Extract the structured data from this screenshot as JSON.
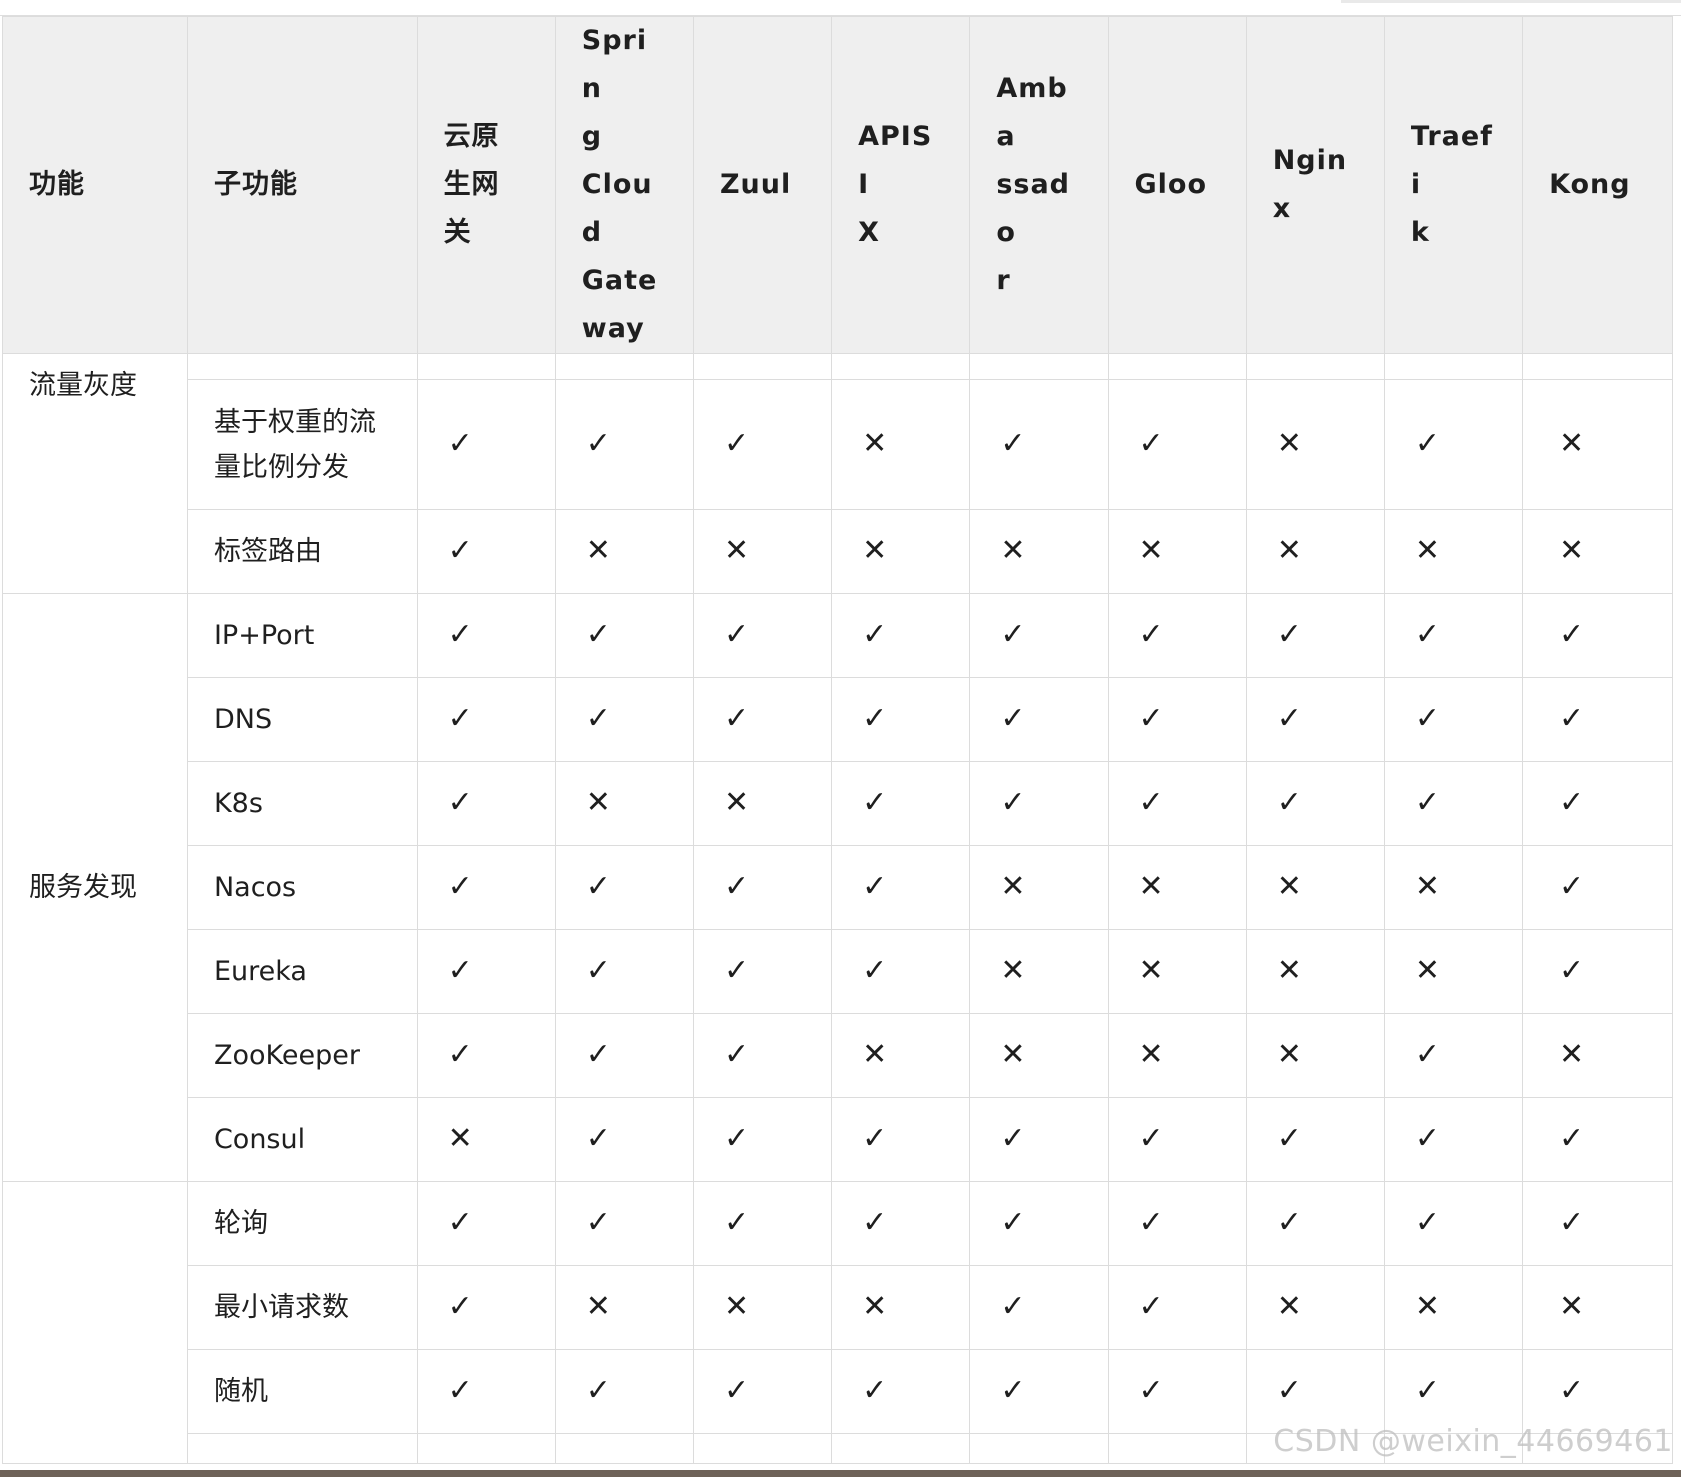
{
  "table": {
    "headers": [
      "功能",
      "子功能",
      "云原生网关",
      "Spring Cloud Gateway",
      "Zuul",
      "APISIX",
      "Ambassador",
      "Gloo",
      "Nginx",
      "Traefik",
      "Kong"
    ],
    "header_lines": [
      [
        "功能"
      ],
      [
        "子功能"
      ],
      [
        "云原",
        "生网",
        "关"
      ],
      [
        "Sprin",
        "g",
        "Cloud",
        "Gate",
        "way"
      ],
      [
        "Zuul"
      ],
      [
        "APISI",
        "X"
      ],
      [
        "Amba",
        "ssado",
        "r"
      ],
      [
        "Gloo"
      ],
      [
        "Nginx"
      ],
      [
        "Traefi",
        "k"
      ],
      [
        "Kong"
      ]
    ],
    "groups": [
      {
        "feature": "流量灰度",
        "rows": [
          {
            "sub": "基于权重的流量比例分发",
            "marks": [
              "✓",
              "✓",
              "✓",
              "✕",
              "✓",
              "✓",
              "✕",
              "✓",
              "✕"
            ]
          },
          {
            "sub": "标签路由",
            "marks": [
              "✓",
              "✕",
              "✕",
              "✕",
              "✕",
              "✕",
              "✕",
              "✕",
              "✕"
            ]
          }
        ]
      },
      {
        "feature": "服务发现",
        "rows": [
          {
            "sub": "IP+Port",
            "marks": [
              "✓",
              "✓",
              "✓",
              "✓",
              "✓",
              "✓",
              "✓",
              "✓",
              "✓"
            ]
          },
          {
            "sub": "DNS",
            "marks": [
              "✓",
              "✓",
              "✓",
              "✓",
              "✓",
              "✓",
              "✓",
              "✓",
              "✓"
            ]
          },
          {
            "sub": "K8s",
            "marks": [
              "✓",
              "✕",
              "✕",
              "✓",
              "✓",
              "✓",
              "✓",
              "✓",
              "✓"
            ]
          },
          {
            "sub": "Nacos",
            "marks": [
              "✓",
              "✓",
              "✓",
              "✓",
              "✕",
              "✕",
              "✕",
              "✕",
              "✓"
            ]
          },
          {
            "sub": "Eureka",
            "marks": [
              "✓",
              "✓",
              "✓",
              "✓",
              "✕",
              "✕",
              "✕",
              "✕",
              "✓"
            ]
          },
          {
            "sub": "ZooKeeper",
            "marks": [
              "✓",
              "✓",
              "✓",
              "✕",
              "✕",
              "✕",
              "✕",
              "✓",
              "✕"
            ]
          },
          {
            "sub": "Consul",
            "marks": [
              "✕",
              "✓",
              "✓",
              "✓",
              "✓",
              "✓",
              "✓",
              "✓",
              "✓"
            ]
          }
        ]
      },
      {
        "feature": "",
        "rows": [
          {
            "sub": "轮询",
            "marks": [
              "✓",
              "✓",
              "✓",
              "✓",
              "✓",
              "✓",
              "✓",
              "✓",
              "✓"
            ]
          },
          {
            "sub": "最小请求数",
            "marks": [
              "✓",
              "✕",
              "✕",
              "✕",
              "✓",
              "✓",
              "✕",
              "✕",
              "✕"
            ]
          },
          {
            "sub": "随机",
            "marks": [
              "✓",
              "✓",
              "✓",
              "✓",
              "✓",
              "✓",
              "✓",
              "✓",
              "✓"
            ]
          }
        ]
      }
    ]
  },
  "watermark": "CSDN @weixin_44669461"
}
